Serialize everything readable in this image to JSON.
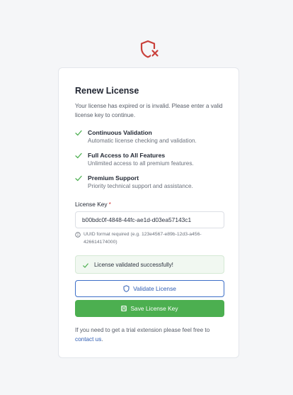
{
  "header": {
    "icon": "shield-x-icon",
    "icon_color": "#c9403b"
  },
  "card": {
    "title": "Renew License",
    "description": "Your license has expired or is invalid. Please enter a valid license key to continue.",
    "features": [
      {
        "title": "Continuous Validation",
        "description": "Automatic license checking and validation.",
        "icon": "check-icon"
      },
      {
        "title": "Full Access to All Features",
        "description": "Unlimited access to all premium features.",
        "icon": "check-icon"
      },
      {
        "title": "Premium Support",
        "description": "Priority technical support and assistance.",
        "icon": "check-icon"
      }
    ],
    "license_key": {
      "label": "License Key",
      "required_marker": "*",
      "value": "b00bdc0f-4848-44fc-ae1d-d03ea57143c1",
      "hint": "UUID format required (e.g. 123e4567-e89b-12d3-a456-426614174000)"
    },
    "status": {
      "text": "License validated successfully!",
      "color": "#4caf50"
    },
    "buttons": {
      "validate_label": "Validate License",
      "save_label": "Save License Key"
    },
    "footer": {
      "text": "If you need to get a trial extension please feel free to",
      "link_text": "contact us",
      "after_link": "."
    }
  },
  "colors": {
    "accent": "#2f5db3",
    "success": "#4caf50",
    "danger": "#c9403b"
  }
}
